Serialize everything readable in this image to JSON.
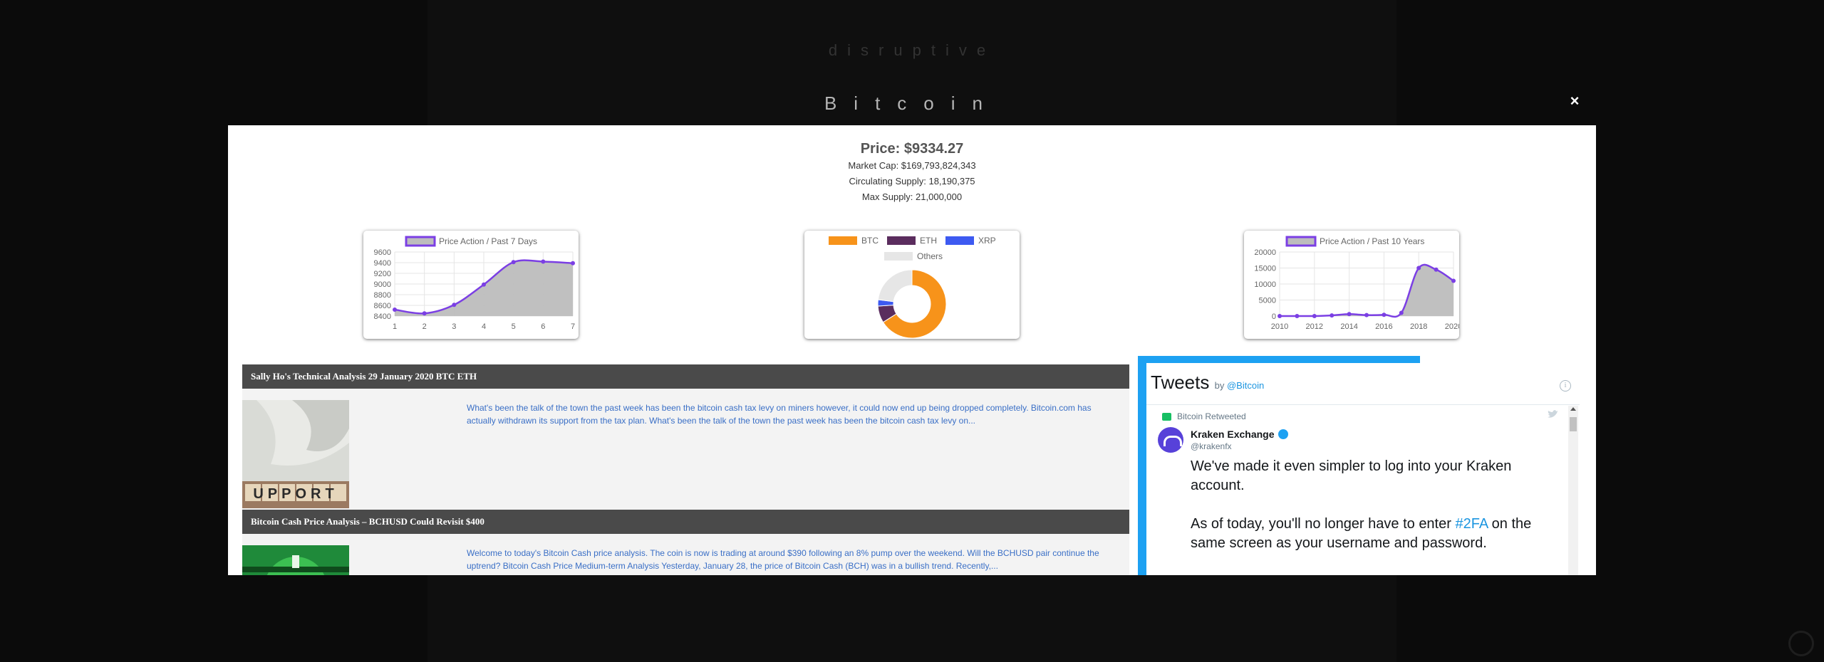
{
  "site": {
    "brand": "disruptive",
    "coin_title": "Bitcoin",
    "close_label": "×"
  },
  "summary": {
    "price_label": "Price: $9334.27",
    "market_cap": "Market Cap: $169,793,824,343",
    "circulating_supply": "Circulating Supply: 18,190,375",
    "max_supply": "Max Supply: 21,000,000"
  },
  "chart_data": [
    {
      "type": "line",
      "legend": "Price Action / Past 7 Days",
      "x": [
        "1",
        "2",
        "3",
        "4",
        "5",
        "6",
        "7"
      ],
      "values": [
        8520,
        8450,
        8610,
        8990,
        9410,
        9420,
        9390
      ],
      "yticks": [
        8400,
        8600,
        8800,
        9000,
        9200,
        9400,
        9600
      ],
      "ylim": [
        8400,
        9600
      ],
      "fill": true,
      "colors": {
        "line": "#7b3fe4",
        "fill": "#bdbdbd"
      }
    },
    {
      "type": "pie",
      "donut": true,
      "labels": [
        "BTC",
        "ETH",
        "XRP",
        "Others"
      ],
      "values": [
        66,
        8,
        3,
        23
      ],
      "colors": [
        "#f7931a",
        "#5b2d5e",
        "#3d5af1",
        "#e6e6e6"
      ]
    },
    {
      "type": "line",
      "legend": "Price Action / Past 10 Years",
      "x": [
        "2010",
        "2012",
        "2014",
        "2016",
        "2018",
        "2020"
      ],
      "points": [
        [
          2010,
          0
        ],
        [
          2011,
          0
        ],
        [
          2012,
          10
        ],
        [
          2013,
          200
        ],
        [
          2014,
          600
        ],
        [
          2015,
          300
        ],
        [
          2016,
          400
        ],
        [
          2017,
          1000
        ],
        [
          2018,
          15000
        ],
        [
          2019,
          14500
        ],
        [
          2020,
          11000
        ]
      ],
      "yticks": [
        0,
        5000,
        10000,
        15000,
        20000
      ],
      "ylim": [
        0,
        20000
      ],
      "xlim": [
        2010,
        2020
      ],
      "fill": true,
      "colors": {
        "line": "#7b3fe4",
        "fill": "#bdbdbd"
      }
    }
  ],
  "news": [
    {
      "title": "Sally Ho's Technical Analysis 29 January 2020 BTC ETH",
      "excerpt": "What's been the talk of the town the past week has been the bitcoin cash tax levy on miners however, it could now end up being dropped completely. Bitcoin.com has actually withdrawn its support from the tax plan. What's been the talk of the town the past week has been the bitcoin cash tax levy on...",
      "thumb_text": "UPPORT"
    },
    {
      "title": "Bitcoin Cash Price Analysis – BCHUSD Could Revisit $400",
      "excerpt": "Welcome to today's Bitcoin Cash price analysis. The coin is now is trading at around $390 following an 8% pump over the weekend. Will the BCHUSD pair continue the uptrend? Bitcoin Cash Price Medium-term Analysis Yesterday, January 28, the price of Bitcoin Cash (BCH) was in a bullish trend. Recently,...",
      "thumb_text": ""
    }
  ],
  "twitter": {
    "heading": "Tweets",
    "by_prefix": "by",
    "by_handle": "@Bitcoin",
    "info": "i",
    "retweet_label": "Bitcoin Retweeted",
    "author_name": "Kraken Exchange",
    "author_handle": "@krakenfx",
    "body_1": "We've made it even simpler to log into your Kraken account.",
    "body_2_pre": "As of today, you'll no longer have to enter ",
    "body_2_tag": "#2FA",
    "body_2_post": " on the same screen as your username and password."
  }
}
